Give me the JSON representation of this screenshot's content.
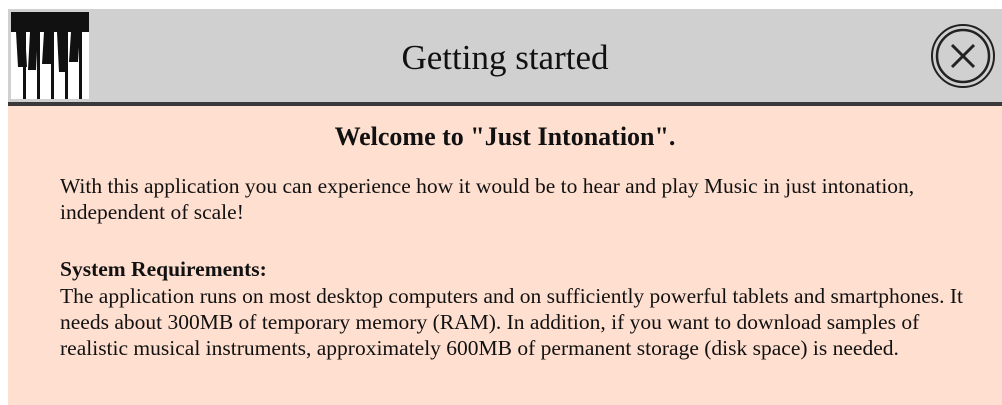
{
  "dialog": {
    "title": "Getting started",
    "icons": {
      "app": "piano-keys-icon",
      "close": "close-circle-icon"
    }
  },
  "content": {
    "welcome": "Welcome to \"Just Intonation\".",
    "intro": "With this application you can experience how it would be to hear and play Music in just intonation, independent of scale!",
    "requirements_heading": "System Requirements:",
    "requirements_text": "The application runs on most desktop computers and on sufficiently powerful tablets and smartphones. It needs about 300MB of temporary memory (RAM). In addition, if you want to download samples of realistic musical instruments, approximately 600MB of permanent storage (disk space) is needed."
  },
  "colors": {
    "titlebar_bg": "#d0d0d0",
    "content_bg": "#fedfd0",
    "divider": "#3a3a3a"
  }
}
